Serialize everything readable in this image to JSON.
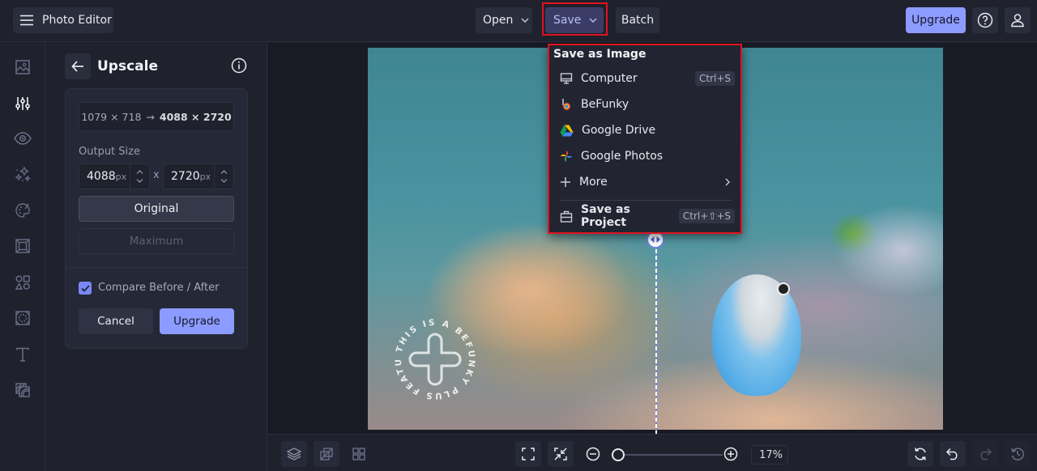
{
  "app": {
    "title": "Photo Editor",
    "menu_icon": "hamburger-menu-icon"
  },
  "topbar": {
    "open_label": "Open",
    "save_label": "Save",
    "batch_label": "Batch",
    "upgrade_label": "Upgrade",
    "help_icon": "help-circle-icon",
    "account_icon": "user-icon"
  },
  "save_menu": {
    "heading": "Save as Image",
    "items": [
      {
        "label": "Computer",
        "icon": "monitor-icon",
        "shortcut": "Ctrl+S"
      },
      {
        "label": "BeFunky",
        "icon": "befunky-logo-icon",
        "shortcut": ""
      },
      {
        "label": "Google Drive",
        "icon": "google-drive-icon",
        "shortcut": ""
      },
      {
        "label": "Google Photos",
        "icon": "google-photos-icon",
        "shortcut": ""
      },
      {
        "label": "More",
        "icon": "plus-icon",
        "shortcut": "",
        "submenu": true
      }
    ],
    "project_item": {
      "label": "Save as Project",
      "icon": "briefcase-icon",
      "shortcut": "Ctrl+⇧+S"
    }
  },
  "left_nav": {
    "items": [
      {
        "name": "image-manager",
        "icon": "image-icon",
        "active": false
      },
      {
        "name": "edit",
        "icon": "sliders-icon",
        "active": true
      },
      {
        "name": "touch-up",
        "icon": "eye-icon",
        "active": false
      },
      {
        "name": "effects",
        "icon": "sparkles-icon",
        "active": false
      },
      {
        "name": "artsy",
        "icon": "palette-icon",
        "active": false
      },
      {
        "name": "frames",
        "icon": "frame-icon",
        "active": false
      },
      {
        "name": "graphics",
        "icon": "shapes-icon",
        "active": false
      },
      {
        "name": "overlays",
        "icon": "overlay-icon",
        "active": false
      },
      {
        "name": "text",
        "icon": "text-icon",
        "active": false
      },
      {
        "name": "textures",
        "icon": "texture-icon",
        "active": false
      }
    ]
  },
  "panel": {
    "title": "Upscale",
    "original_dims": "1079 × 718",
    "arrow": "→",
    "new_dims": "4088 × 2720",
    "output_size_label": "Output Size",
    "width_value": "4088",
    "height_value": "2720",
    "unit": "px",
    "times": "x",
    "original_label": "Original",
    "maximum_label": "Maximum",
    "compare_label": "Compare Before / After",
    "compare_checked": true,
    "cancel_label": "Cancel",
    "upgrade_label": "Upgrade"
  },
  "canvas": {
    "watermark_text": "THIS IS A BEFUNKY PLUS FEATURE •",
    "compare_position": 0.5
  },
  "bottombar": {
    "left_tools": [
      "layers-icon",
      "compare-icon",
      "grid-icon"
    ],
    "fit_icon": "fullscreen-icon",
    "shrink_icon": "shrink-icon",
    "zoom_level": "17%",
    "zoom_fraction": 0.0,
    "right_tools": [
      "sync-icon",
      "undo-icon",
      "redo-icon",
      "history-icon"
    ]
  },
  "colors": {
    "accent": "#8c9bff",
    "highlight": "#e0141e",
    "background": "#1f212c"
  }
}
